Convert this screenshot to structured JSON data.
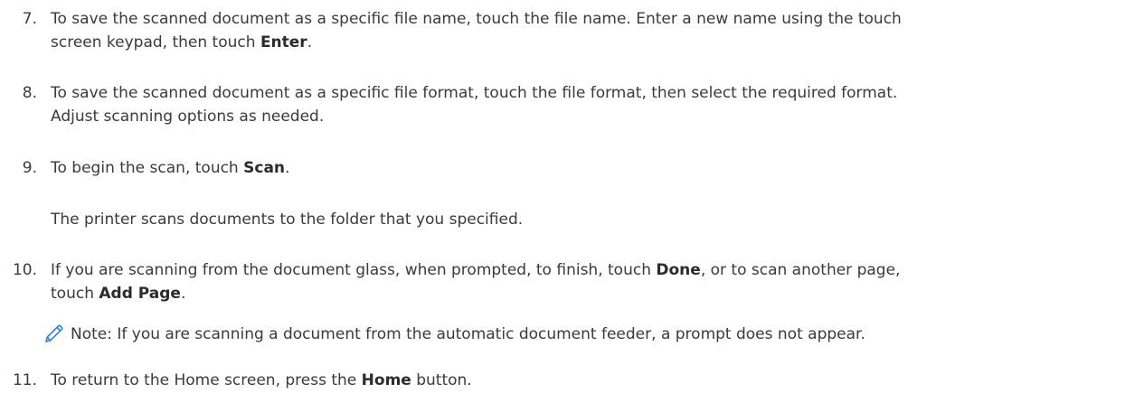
{
  "steps": [
    {
      "number": "7.",
      "lines": [
        [
          "To save the scanned document as a specific file name, touch the file name. Enter a new name using the touch"
        ],
        [
          "screen keypad, then touch ",
          {
            "b": "Enter"
          },
          "."
        ]
      ]
    },
    {
      "number": "8.",
      "lines": [
        [
          "To save the scanned document as a specific file format, touch the file format, then select the required format."
        ],
        [
          "Adjust scanning options as needed."
        ]
      ]
    },
    {
      "number": "9.",
      "lines": [
        [
          "To begin the scan, touch ",
          {
            "b": "Scan"
          },
          "."
        ]
      ],
      "followup": "The printer scans documents to the folder that you specified."
    },
    {
      "number": "10.",
      "lines": [
        [
          "If you are scanning from the document glass, when prompted, to finish, touch ",
          {
            "b": "Done"
          },
          ", or to scan another page,"
        ],
        [
          "touch ",
          {
            "b": "Add Page"
          },
          "."
        ]
      ]
    },
    {
      "number": "11.",
      "lines": [
        [
          "To return to the Home screen, press the ",
          {
            "b": "Home"
          },
          " button."
        ]
      ]
    }
  ],
  "note": {
    "icon": "pencil-icon",
    "text": "Note: If you are scanning a document from the automatic document feeder, a prompt does not appear."
  }
}
